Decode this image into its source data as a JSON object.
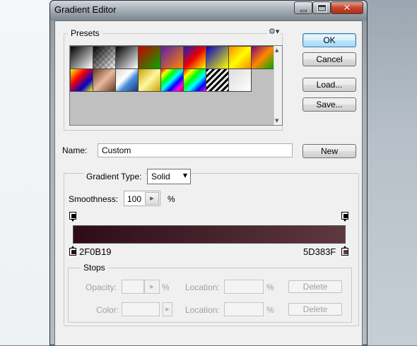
{
  "window": {
    "title": "Gradient Editor",
    "close_glyph": "✕"
  },
  "presets": {
    "label": "Presets",
    "gear_icon": "⚙▾",
    "swatches": [
      "linear-gradient(135deg, #000 0%, #fff 100%)",
      "linear-gradient(135deg, #000 0%, rgba(0,0,0,0) 100%)",
      "linear-gradient(135deg, #000 0%, #fff 100%)",
      "linear-gradient(135deg, #c00 0%, #0a0 100%)",
      "linear-gradient(135deg, #5a1fa8 0%, #f80 100%)",
      "linear-gradient(135deg, #1a1ac8 0%, #e00 50%, #ff0 100%)",
      "linear-gradient(135deg, #0000c8 0%, #ff0 100%)",
      "linear-gradient(135deg, #f80 0%, #ff0 50%, #f80 100%)",
      "linear-gradient(135deg, #800080 0%, #f80 50%, #0a0 100%)",
      "linear-gradient(135deg, #ff0 0%, #f00 35%, #00c 70%, #ff0 100%)",
      "linear-gradient(135deg, #6b3a25 0%, #e8b89a 50%, #6b3a25 100%)",
      "linear-gradient(135deg, #d8d8d8 0%, #fff 40%, #4a8fd8 60%, #1a3a7a 100%)",
      "linear-gradient(135deg, #c8a000 0%, #fff8a0 50%, #c8a000 100%)",
      "linear-gradient(135deg, #f00, #ff0, #0f0, #0ff, #00f, #f0f, #f00)",
      "linear-gradient(135deg, #f00, #ff0, #0f0, #0ff, #00f, #f0f)",
      "repeating-linear-gradient(135deg, #000 0 3px, #fff 3px 6px)",
      "linear-gradient(135deg, #ddd 0%, #fff 100%)"
    ]
  },
  "buttons": {
    "ok": "OK",
    "cancel": "Cancel",
    "load": "Load...",
    "save": "Save...",
    "new": "New"
  },
  "name": {
    "label": "Name:",
    "value": "Custom"
  },
  "gradient": {
    "type_label": "Gradient Type:",
    "type_value": "Solid",
    "smoothness_label": "Smoothness:",
    "smoothness_value": "100",
    "smoothness_unit": "%",
    "color_start": "#2F0B19",
    "color_end": "#5D383F",
    "left_stop_label": "2F0B19",
    "right_stop_label": "5D383F"
  },
  "stops": {
    "label": "Stops",
    "opacity_label": "Opacity:",
    "color_label": "Color:",
    "location_label": "Location:",
    "percent": "%",
    "delete_label": "Delete"
  }
}
